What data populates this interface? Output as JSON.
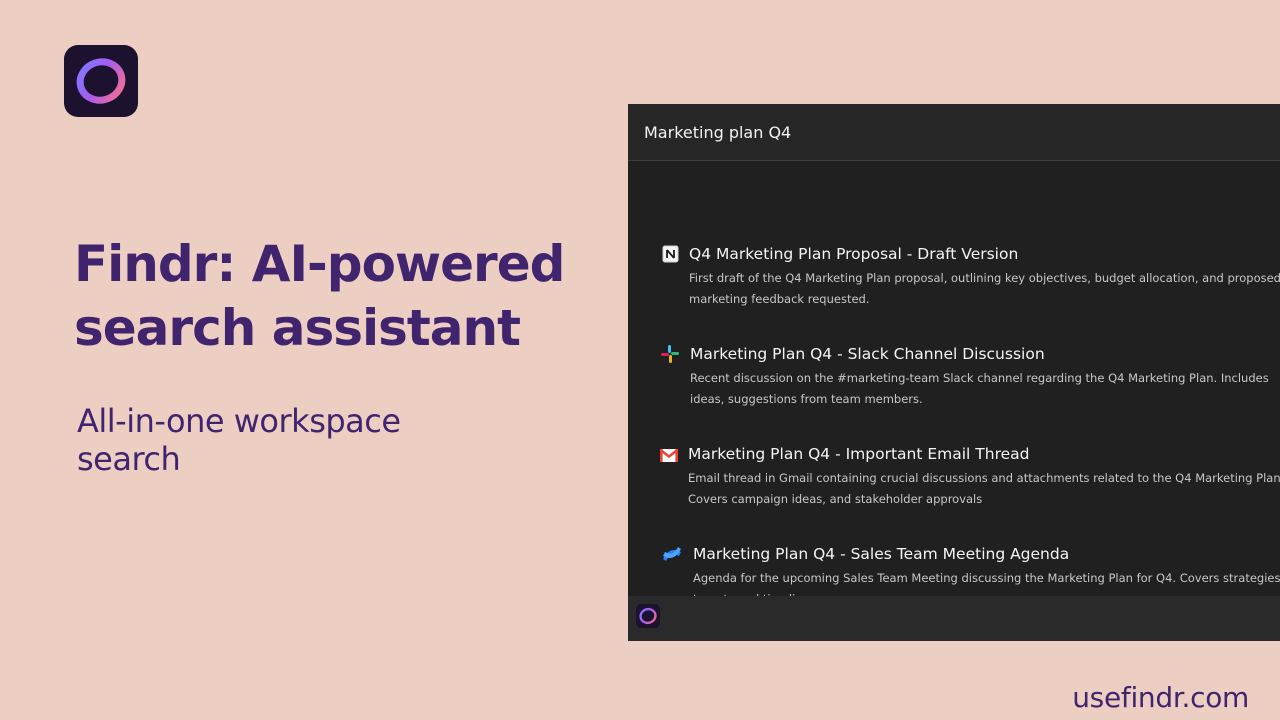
{
  "brand": {
    "logo_icon": "findr-ring-icon",
    "accent_color": "#41246e",
    "background_color": "#eccfc2"
  },
  "hero": {
    "headline": "Findr: AI-powered search assistant",
    "subheadline": "All-in-one workspace search"
  },
  "footer": {
    "url": "usefindr.com"
  },
  "search": {
    "query": "Marketing plan Q4",
    "results": [
      {
        "icon": "notion-icon",
        "title": "Q4 Marketing Plan Proposal - Draft Version",
        "description": "First draft of the Q4 Marketing Plan proposal, outlining key objectives, budget allocation, and proposed marketing feedback requested."
      },
      {
        "icon": "slack-icon",
        "title": "Marketing Plan Q4 - Slack Channel Discussion",
        "description": "Recent discussion on the #marketing-team Slack channel regarding the Q4 Marketing Plan. Includes ideas, suggestions from team members."
      },
      {
        "icon": "gmail-icon",
        "title": "Marketing Plan Q4 - Important Email Thread",
        "description": "Email thread in Gmail containing crucial discussions and attachments related to the Q4 Marketing Plan. Covers campaign ideas, and stakeholder approvals"
      },
      {
        "icon": "confluence-icon",
        "title": "Marketing Plan Q4 - Sales Team Meeting Agenda",
        "description": "Agenda for the upcoming Sales Team Meeting discussing the Marketing Plan for Q4. Covers strategies, targets and timelines."
      }
    ]
  }
}
